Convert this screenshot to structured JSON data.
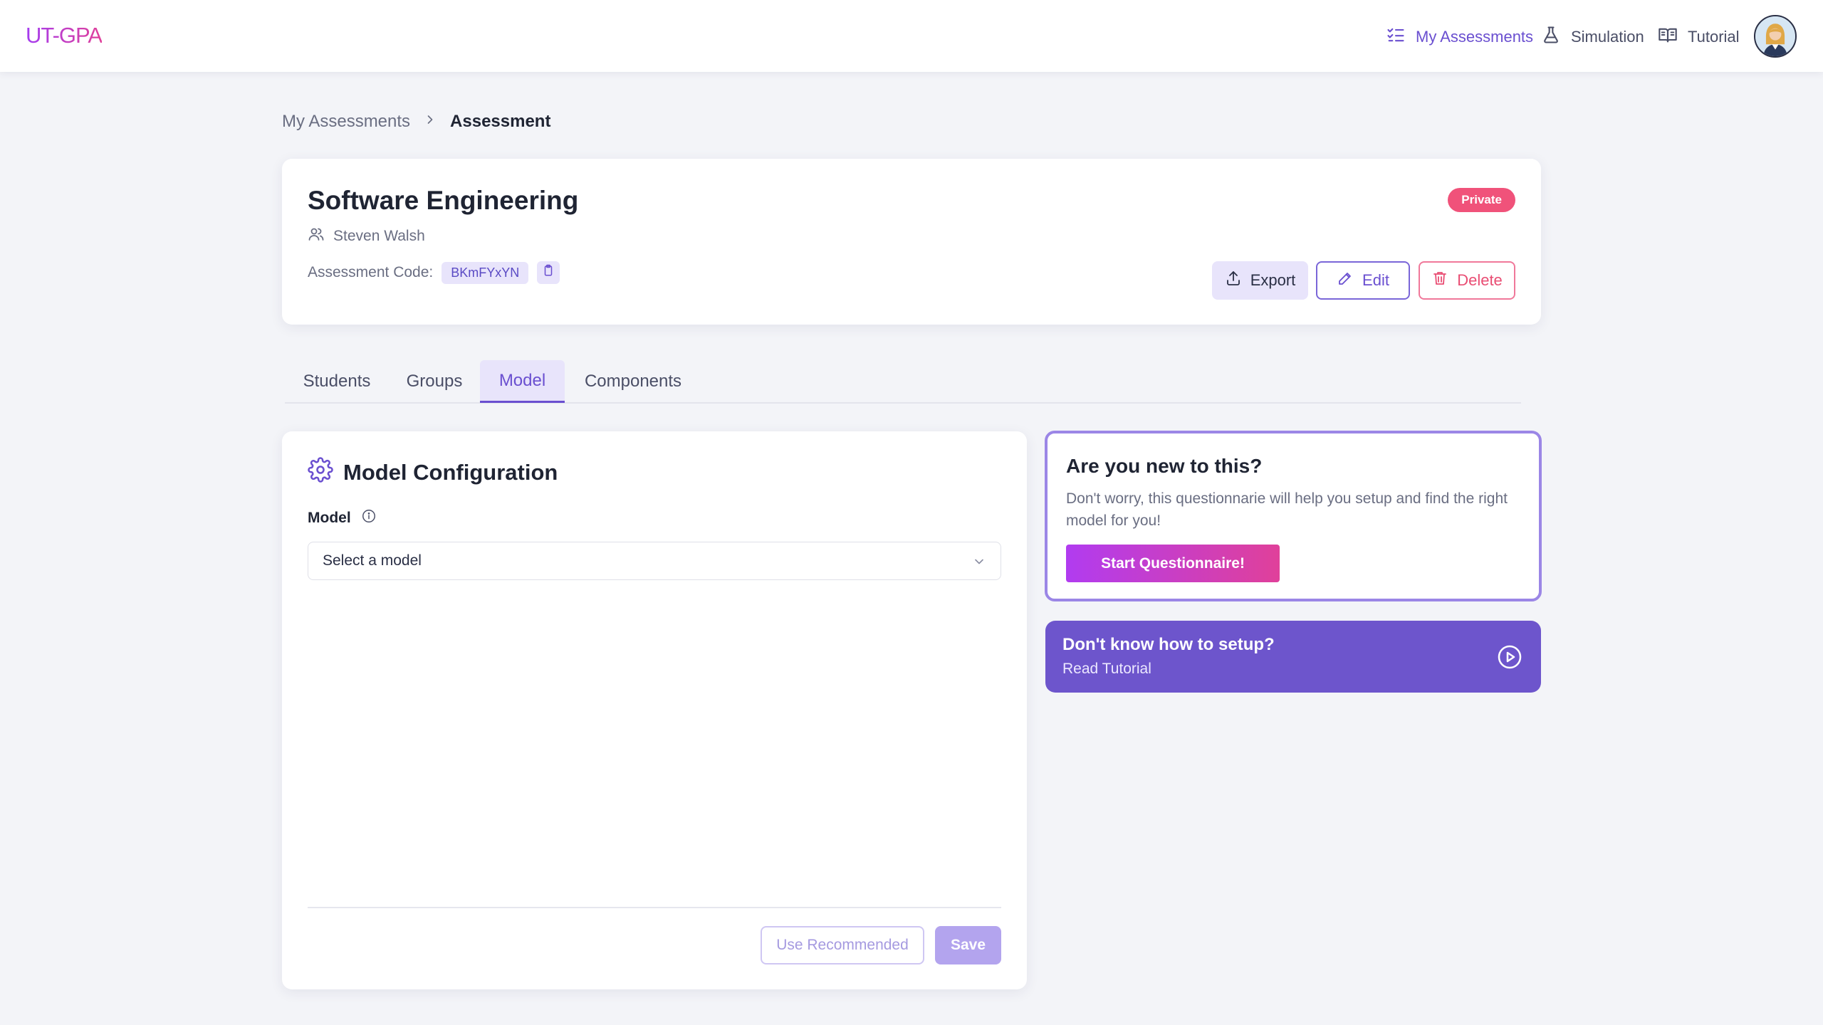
{
  "app": {
    "logo": "UT-GPA"
  },
  "nav": {
    "my_assessments": "My Assessments",
    "simulation": "Simulation",
    "tutorial": "Tutorial"
  },
  "breadcrumb": {
    "parent": "My Assessments",
    "current": "Assessment"
  },
  "assessment": {
    "title": "Software Engineering",
    "owner": "Steven Walsh",
    "code_label": "Assessment Code:",
    "code": "BKmFYxYN",
    "visibility": "Private"
  },
  "actions": {
    "export": "Export",
    "edit": "Edit",
    "delete": "Delete"
  },
  "tabs": [
    "Students",
    "Groups",
    "Model",
    "Components"
  ],
  "active_tab": "Model",
  "model_config": {
    "title": "Model Configuration",
    "model_label": "Model",
    "select_placeholder": "Select a model",
    "use_recommended": "Use Recommended",
    "save": "Save"
  },
  "new_card": {
    "title": "Are you new to this?",
    "description": "Don't worry, this questionnarie will help you setup and find the right model for you!",
    "button": "Start Questionnaire!"
  },
  "tutorial_card": {
    "title": "Don't know how to setup?",
    "subtitle": "Read Tutorial"
  },
  "colors": {
    "accent": "#6a4fd0",
    "accent_light": "#e8e4fb",
    "danger": "#f0527a",
    "tutorial_bg": "#6d55cc",
    "gradient_start": "#b13cf0",
    "gradient_end": "#e0409a"
  },
  "icons": {
    "nav_my_assessments": "checklist-icon",
    "nav_simulation": "flask-icon",
    "nav_tutorial": "book-icon",
    "owner": "users-icon",
    "copy": "clipboard-icon",
    "export": "upload-icon",
    "edit": "pencil-icon",
    "delete": "trash-icon",
    "model_config": "gear-icon",
    "model_info": "info-icon",
    "select": "chevron-down-icon",
    "tutorial": "play-circle-icon"
  }
}
